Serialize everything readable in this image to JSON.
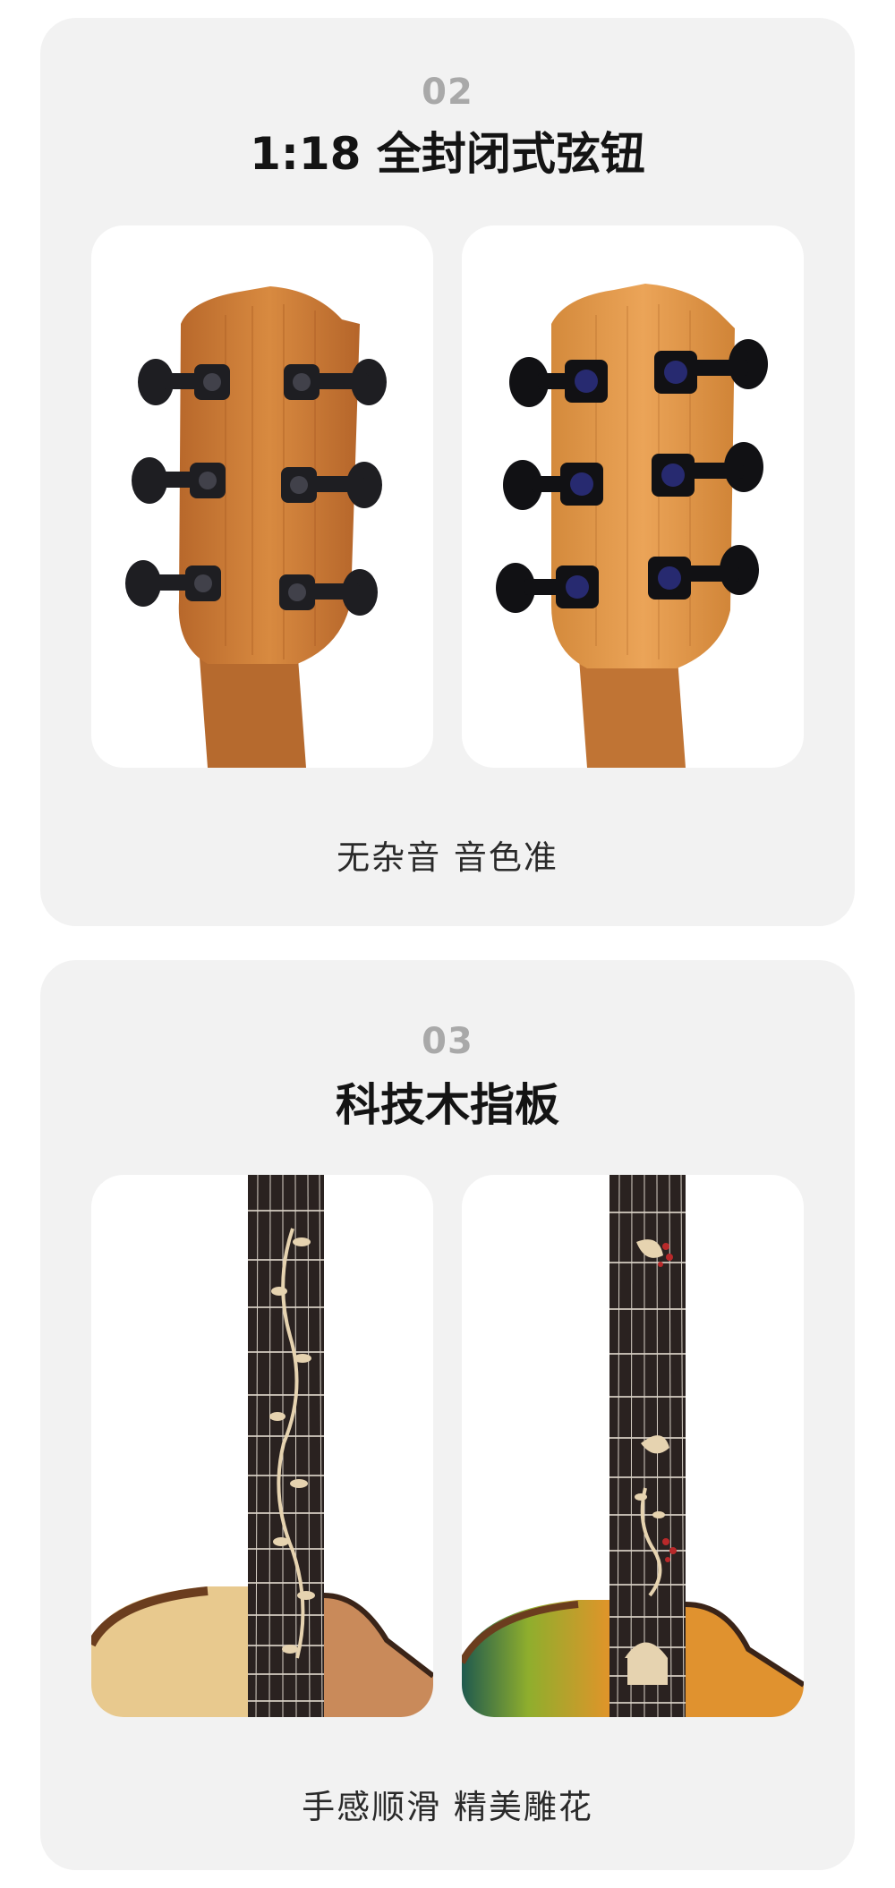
{
  "sections": [
    {
      "number": "02",
      "title": "1:18 全封闭式弦钮",
      "caption": "无杂音 音色准",
      "images": [
        {
          "subject": "mahogany-headstock-dark-tuners"
        },
        {
          "subject": "mahogany-headstock-black-tuners"
        }
      ]
    },
    {
      "number": "03",
      "title": "科技木指板",
      "caption": "手感顺滑 精美雕花",
      "images": [
        {
          "subject": "fretboard-vine-inlay-natural-top"
        },
        {
          "subject": "fretboard-flower-inlay-sunburst-top"
        }
      ]
    }
  ],
  "colors": {
    "card_bg": "#f2f2f2",
    "number": "#a9a9a9",
    "title": "#141414",
    "caption": "#2a2a2a",
    "mahogany": "#c97a35",
    "fretboard": "#2a2220"
  }
}
